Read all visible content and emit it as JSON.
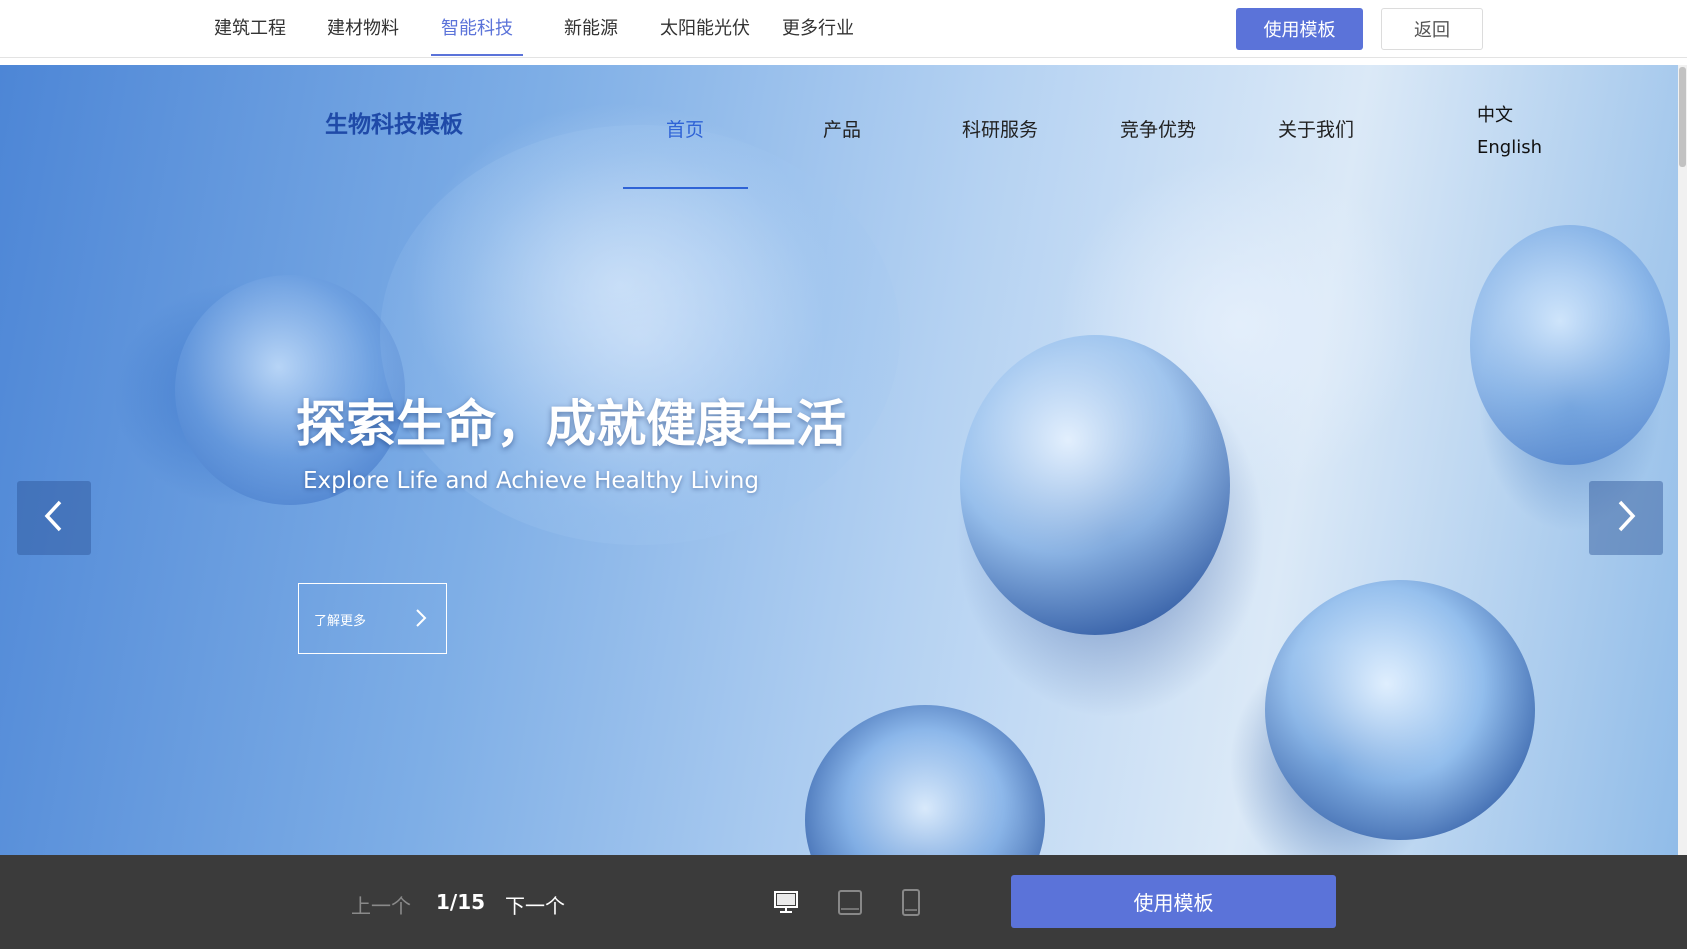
{
  "topbar": {
    "categories": [
      {
        "label": "建筑工程"
      },
      {
        "label": "建材物料"
      },
      {
        "label": "智能科技",
        "active": true
      },
      {
        "label": "新能源"
      },
      {
        "label": "太阳能光伏"
      },
      {
        "label": "更多行业"
      }
    ],
    "use_template": "使用模板",
    "back": "返回"
  },
  "site": {
    "brand": "生物科技模板",
    "nav": [
      {
        "label": "首页",
        "active": true
      },
      {
        "label": "产品"
      },
      {
        "label": "科研服务"
      },
      {
        "label": "竞争优势"
      },
      {
        "label": "关于我们"
      }
    ],
    "lang": {
      "zh": "中文",
      "en": "English"
    },
    "hero": {
      "title": "探索生命，成就健康生活",
      "subtitle": "Explore Life and Achieve Healthy Living",
      "cta": "了解更多"
    }
  },
  "bottombar": {
    "prev": "上一个",
    "counter": "1/15",
    "next": "下一个",
    "devices": [
      "desktop-icon",
      "tablet-icon",
      "mobile-icon"
    ],
    "use_template": "使用模板"
  },
  "colors": {
    "accent": "#5b73d9",
    "brand": "#1f4aa8",
    "nav_active": "#2f63d6",
    "bottom_bg": "#3b3b3b"
  }
}
